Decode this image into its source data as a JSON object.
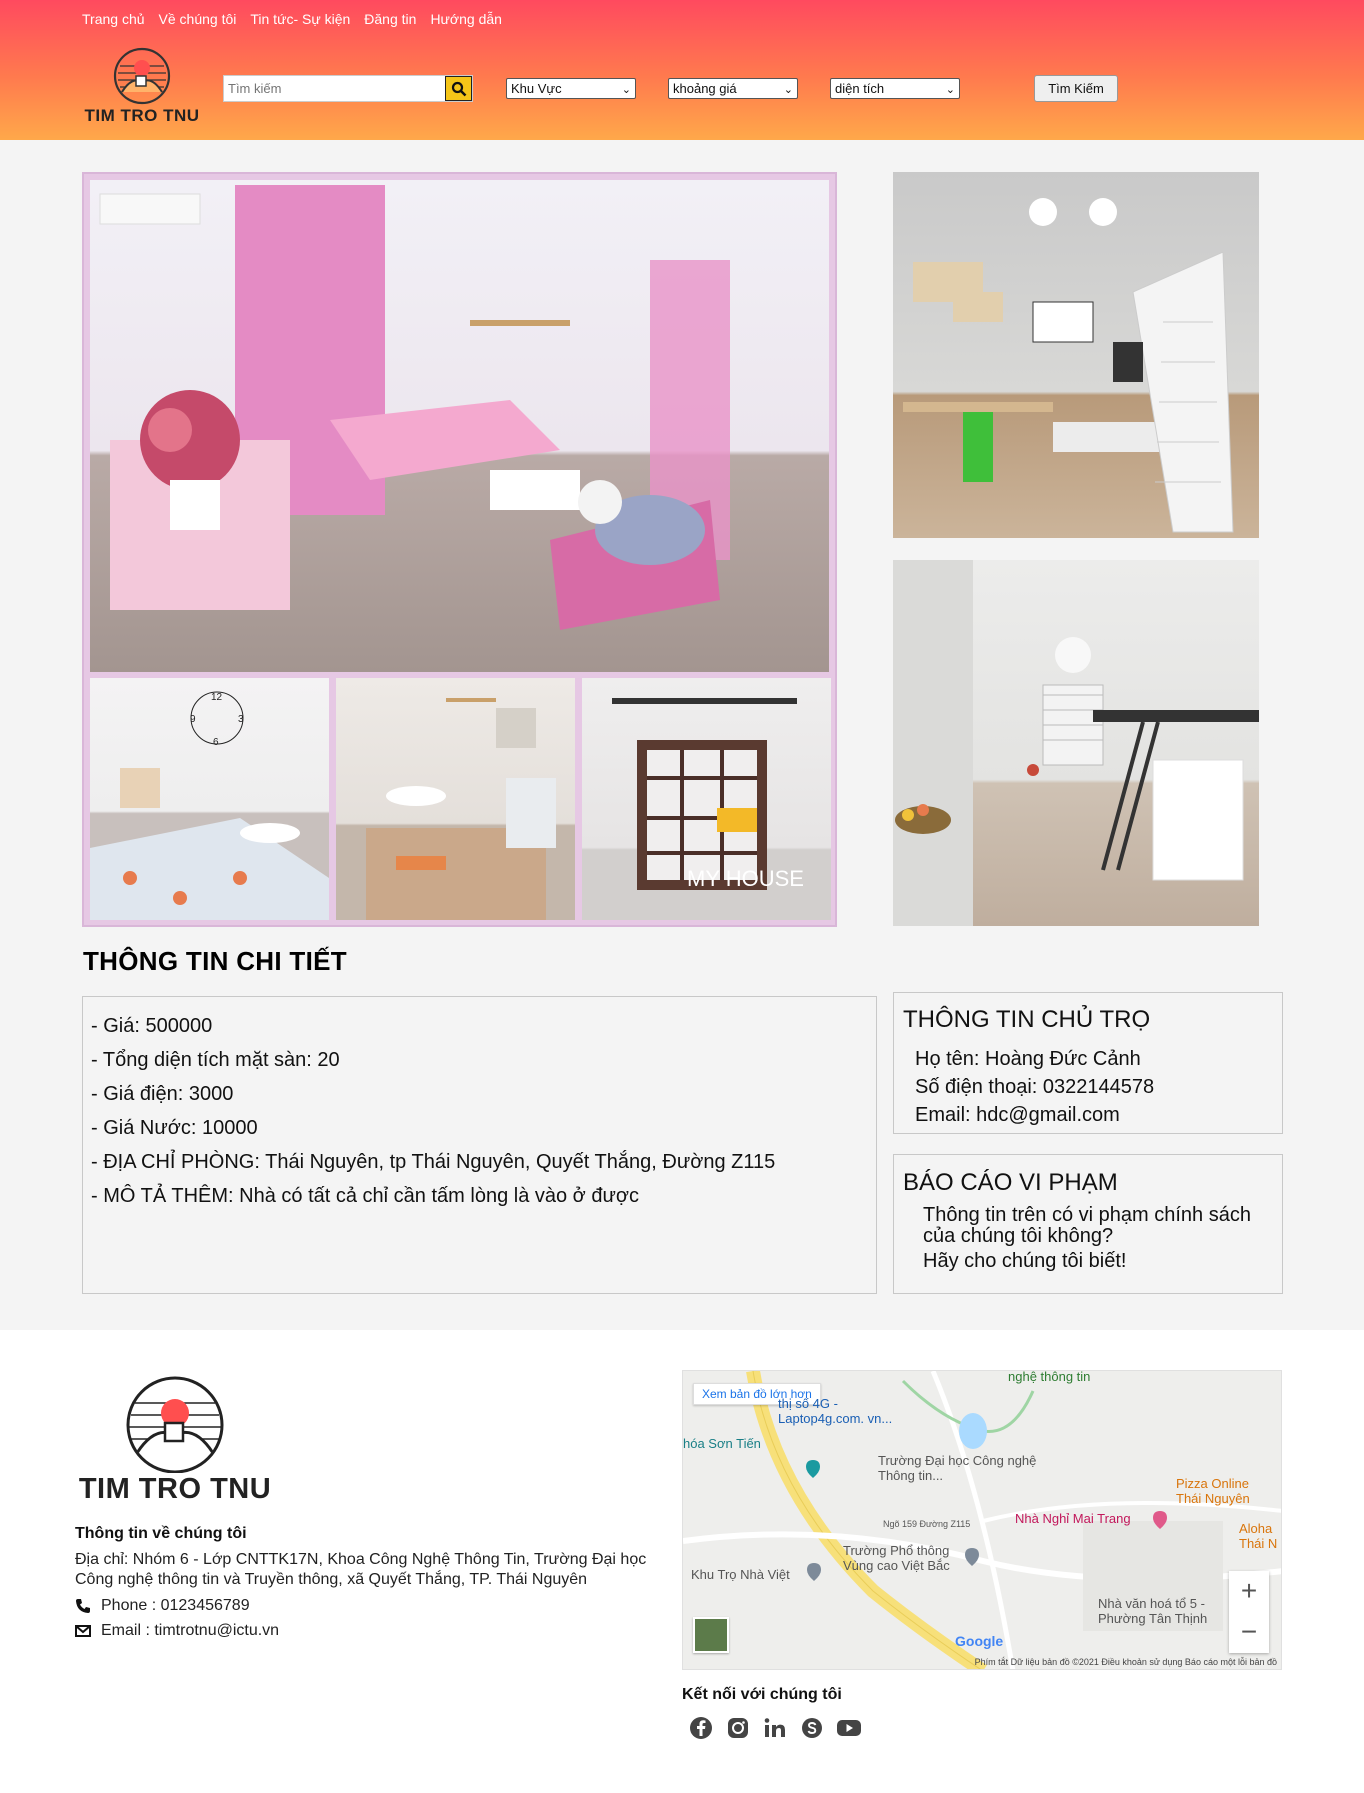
{
  "nav": [
    "Trang chủ",
    "Về chúng tôi",
    "Tin tức- Sự kiện",
    "Đăng tin",
    "Hướng dẫn"
  ],
  "brand": {
    "name": "TIM TRO TNU"
  },
  "search": {
    "placeholder": "Tìm kiếm",
    "button": "Tìm Kiếm"
  },
  "filters": {
    "area": "Khu Vực",
    "price": "khoảng giá",
    "size": "diện tích"
  },
  "gallery": {
    "watermark": "MY HOUSE"
  },
  "detail": {
    "title": "THÔNG TIN CHI TIẾT",
    "lines": [
      "- Giá: 500000",
      "- Tổng diện tích mặt sàn: 20",
      "- Giá điện: 3000",
      "- Giá Nước: 10000",
      "- ĐỊA CHỈ PHÒNG: Thái Nguyên, tp Thái Nguyên, Quyết Thắng, Đường Z115",
      "- MÔ TẢ THÊM: Nhà có tất cả chỉ cần tấm lòng là vào ở được"
    ]
  },
  "owner": {
    "title": "THÔNG TIN CHỦ TRỌ",
    "name": "Họ tên: Hoàng Đức Cảnh",
    "phone": "Số điện thoại: 0322144578",
    "email": "Email: hdc@gmail.com"
  },
  "report": {
    "title": "BÁO CÁO VI PHẠM",
    "question": "Thông tin trên có vi phạm chính sách của chúng tôi không?",
    "cta": "Hãy cho chúng tôi biết!"
  },
  "footer": {
    "about_title": "Thông tin về chúng tôi",
    "address": "Địa chỉ: Nhóm 6 - Lớp CNTTK17N, Khoa Công Nghệ Thông Tin, Trường Đại học Công nghệ thông tin và Truyền thông, xã Quyết Thắng, TP. Thái Nguyên",
    "phone": "Phone : 0123456789",
    "email": "Email :  timtrotnu@ictu.vn",
    "connect": "Kết nối với chúng tôi"
  },
  "map": {
    "link": "Xem bản đồ lớn hơn",
    "labels": [
      "nghệ thông tin",
      "thị số 4G - Laptop4g.com. vn...",
      "hóa Sơn Tiến",
      "Trường Đại học Công nghệ Thông tin...",
      "Pizza Online Thái Nguyên",
      "Nhà Nghỉ Mai Trang",
      "Aloha Thái N",
      "Trường Phổ thông Vùng cao Việt Bắc",
      "Khu Trọ Nhà Việt",
      "Nhà văn hoá tổ 5 - Phường Tân Thịnh",
      "Ngõ 159 Đường Z115"
    ],
    "footer": "Phím tắt   Dữ liệu bản đồ ©2021   Điều khoản sử dụng   Báo cáo một lỗi bản đồ",
    "google": "Google"
  },
  "colors": {
    "header_top": "#ff4a5f",
    "header_bottom": "#ffa84a",
    "search_button": "#f5c518"
  },
  "icons": [
    "search-icon",
    "chevron-down-icon",
    "phone-icon",
    "envelope-icon",
    "facebook-icon",
    "instagram-icon",
    "linkedin-icon",
    "skype-icon",
    "youtube-icon",
    "map-pin-icon"
  ]
}
